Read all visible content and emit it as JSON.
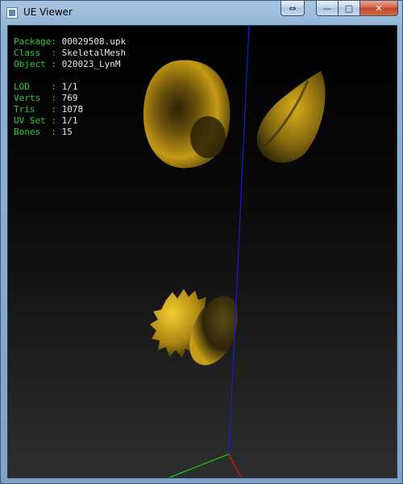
{
  "window": {
    "title": "UE Viewer",
    "buttons": {
      "extra": "⇔",
      "minimize": "—",
      "maximize": "□",
      "close": "✕"
    }
  },
  "info": {
    "mesh": [
      {
        "label": "Package",
        "sep": ": ",
        "value": "00029508.upk"
      },
      {
        "label": "Class  ",
        "sep": ": ",
        "value": "SkeletalMesh"
      },
      {
        "label": "Object ",
        "sep": ": ",
        "value": "020023_LynM"
      }
    ],
    "stats": [
      {
        "label": "LOD    ",
        "sep": ": ",
        "value": "1/1"
      },
      {
        "label": "Verts  ",
        "sep": ": ",
        "value": "769"
      },
      {
        "label": "Tris   ",
        "sep": ": ",
        "value": "1078"
      },
      {
        "label": "UV Set ",
        "sep": ": ",
        "value": "1/1"
      },
      {
        "label": "Bones  ",
        "sep": ": ",
        "value": "15"
      }
    ]
  },
  "colors": {
    "label": "#27d227",
    "value": "#e8e8e8",
    "axis_x": "#e01515",
    "axis_y": "#18d418",
    "axis_z": "#1a1ad8",
    "mesh_light": "#e0b418",
    "mesh_dark": "#3a2e08"
  }
}
